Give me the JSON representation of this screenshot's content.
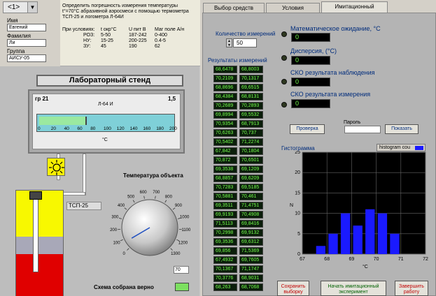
{
  "header": {
    "variant": "<1>",
    "name_label": "Имя",
    "name_value": "Евгений",
    "surname_label": "Фамилия",
    "surname_value": "Ли",
    "group_label": "Группа",
    "group_value": "АИСУ-05"
  },
  "task": {
    "text": "Определить погрешность измерения температуры t°=70°С абразивной аэросмеси с помощью термометра ТСП-25 и логометра Л-64И",
    "conditions_title": "При условиях:",
    "col_headers": [
      "t окр°С",
      "U пит В",
      "Маг поле А/н"
    ],
    "rows": [
      {
        "name": "РОЗ:",
        "v1": "5-50",
        "v2": "187-242",
        "v3": "0-400"
      },
      {
        "name": "НУ:",
        "v1": "15-25",
        "v2": "200-225",
        "v3": "0.4-5"
      },
      {
        "name": "ЗУ:",
        "v1": "45",
        "v2": "190",
        "v3": "62"
      }
    ]
  },
  "stand": {
    "title": "Лабораторный стенд",
    "instrument_left": "гр 21",
    "instrument_right": "1,5",
    "instrument_model": "Л-64 И",
    "unit": "°С",
    "scale_ticks": [
      "0",
      "20",
      "40",
      "60",
      "80",
      "100",
      "120",
      "140",
      "160",
      "180",
      "200"
    ],
    "scale_fill_fraction": 0.36,
    "sensor": "ТСП-25",
    "temp_title": "Температура объекта",
    "dial_ticks": [
      "0",
      "100",
      "200",
      "300",
      "400",
      "500",
      "600",
      "700",
      "800",
      "900",
      "1000",
      "1100",
      "1200",
      "1300"
    ],
    "dial_value": 70,
    "dial_field": "70",
    "schema_label": "Схема собрана верно"
  },
  "tabs": [
    {
      "label": "Выбор средств измерения",
      "active": false
    },
    {
      "label": "Условия эксплуатации",
      "active": false
    },
    {
      "label": "Имитационный эксперимент",
      "active": true
    }
  ],
  "experiment": {
    "count_label": "Количество измерений",
    "count_value": "50",
    "results_label": "Результаты измерений",
    "results_col1": [
      "68,6478",
      "70,2109",
      "68,8696",
      "68,4384",
      "70,2689",
      "69,8994",
      "70,9354",
      "70,6263",
      "70,5402",
      "67,842",
      "70,872",
      "69,3538",
      "68,8857",
      "70,7283",
      "70,5881",
      "69,3511",
      "69,9193",
      "71,5113",
      "70,2998",
      "69,3536",
      "69,856",
      "67,4932",
      "70,1367",
      "70,3776",
      "68,263"
    ],
    "results_col2": [
      "68,8003",
      "70,1317",
      "69,6515",
      "68,8131",
      "70,2893",
      "69,5532",
      "68,7913",
      "70,737",
      "71,2274",
      "70,1804",
      "70,6501",
      "69,1209",
      "69,6209",
      "69,5185",
      "70,461",
      "71,4751",
      "70,4908",
      "69,8416",
      "69,9132",
      "69,6312",
      "71,5369",
      "69,7605",
      "71,1747",
      "68,9031",
      "68,7068"
    ],
    "stats": [
      {
        "label": "Математическое ожидание, °С",
        "value": "0"
      },
      {
        "label": "Дисперсия, (°С)",
        "value": "0"
      },
      {
        "label": "СКО результата наблюдения",
        "value": "0"
      },
      {
        "label": "СКО результата измерения",
        "value": "0"
      }
    ],
    "check_button": "Проверка",
    "password_label": "Пароль",
    "password_value": "",
    "show_button": "Показать",
    "histogram_title": "Гистограмма",
    "histogram_legend": "histogram cou",
    "save_button": "Сохранить выборку",
    "start_button": "Начать имитационный эксперимент",
    "finish_button": "Завершить работу"
  },
  "colors": {
    "bar": "#1a1aff",
    "digital_text": "#74ff4c",
    "label_blue": "#002c7c"
  },
  "chart_data": {
    "type": "bar",
    "title": "Гистограмма",
    "xlabel": "°С",
    "ylabel": "N",
    "x": [
      67.75,
      68.25,
      68.75,
      69.25,
      69.75,
      70.25,
      70.75,
      71.25,
      71.75
    ],
    "values": [
      2,
      5,
      10,
      7,
      11,
      10,
      5,
      0,
      0
    ],
    "xlim": [
      67,
      72
    ],
    "ylim": [
      0,
      25
    ],
    "xticks": [
      "67",
      "68",
      "69",
      "70",
      "71",
      "72"
    ],
    "yticks": [
      "0",
      "5",
      "10",
      "15",
      "20",
      "25"
    ],
    "grid": true,
    "legend": "histogram cou"
  }
}
